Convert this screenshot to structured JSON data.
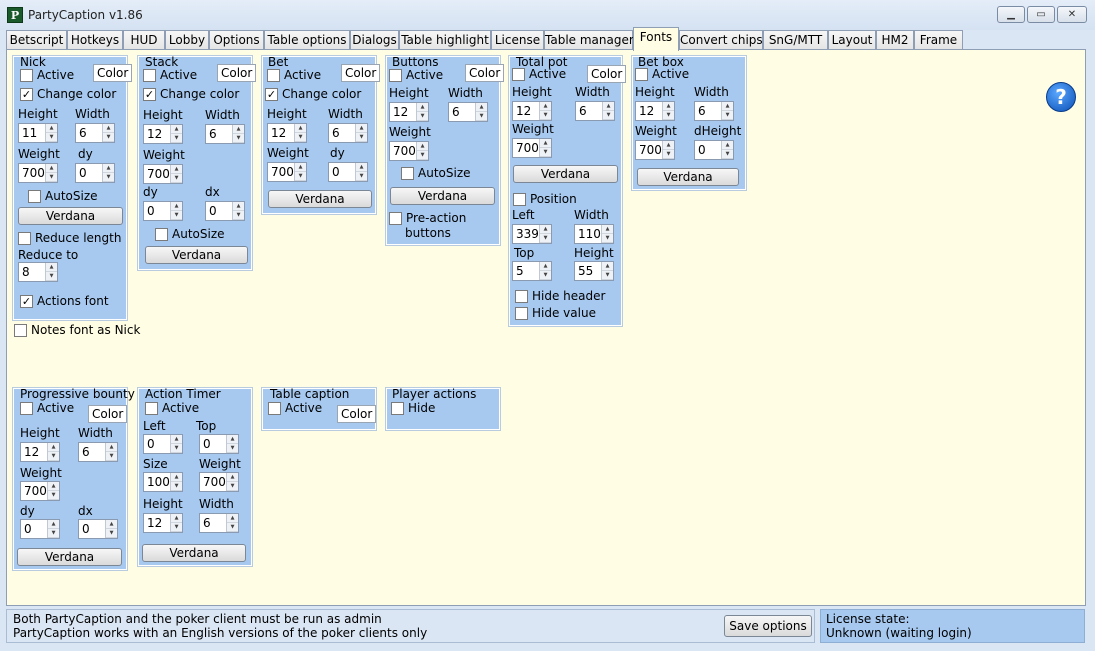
{
  "window": {
    "title": "PartyCaption v1.86",
    "icon_letter": "P",
    "minimize": "▁",
    "maximize": "▭",
    "close": "✕"
  },
  "tabs": [
    "Betscript",
    "Hotkeys",
    "HUD",
    "Lobby",
    "Options",
    "Table options",
    "Dialogs",
    "Table highlight",
    "License",
    "Table manager",
    "Fonts",
    "Convert chips",
    "SnG/MTT",
    "Layout",
    "HM2",
    "Frame"
  ],
  "active_tab": "Fonts",
  "common": {
    "active": "Active",
    "color": "Color",
    "change_color": "Change color",
    "height": "Height",
    "width": "Width",
    "weight": "Weight",
    "dy": "dy",
    "dx": "dx",
    "autosize": "AutoSize",
    "font": "Verdana",
    "left": "Left",
    "top": "Top",
    "size": "Size",
    "dheight": "dHeight",
    "check": "✓"
  },
  "nick": {
    "title": "Nick",
    "height": "11",
    "width": "6",
    "weight": "700",
    "dy": "0",
    "reduce_length": "Reduce length",
    "reduce_to_label": "Reduce to",
    "reduce_to": "8",
    "actions_font": "Actions font"
  },
  "notes_font": "Notes font as Nick",
  "stack": {
    "title": "Stack",
    "height": "12",
    "width": "6",
    "weight": "700",
    "dy": "0",
    "dx": "0"
  },
  "bet": {
    "title": "Bet",
    "height": "12",
    "width": "6",
    "weight": "700",
    "dy": "0"
  },
  "buttons": {
    "title": "Buttons",
    "height": "12",
    "width": "6",
    "weight": "700",
    "preaction": "Pre-action",
    "preaction2": "buttons"
  },
  "total_pot": {
    "title": "Total pot",
    "height": "12",
    "width": "6",
    "weight": "700",
    "position": "Position",
    "left": "339",
    "width2": "110",
    "top": "5",
    "height2": "55",
    "hide_header": "Hide header",
    "hide_value": "Hide value"
  },
  "bet_box": {
    "title": "Bet box",
    "height": "12",
    "width": "6",
    "weight": "700",
    "dheight": "0"
  },
  "progressive_bounty": {
    "title": "Progressive bounty",
    "height": "12",
    "width": "6",
    "weight": "700",
    "dy": "0",
    "dx": "0"
  },
  "action_timer": {
    "title": "Action Timer",
    "left": "0",
    "top": "0",
    "size": "100",
    "weight": "700",
    "height": "12",
    "width": "6"
  },
  "table_caption": {
    "title": "Table caption"
  },
  "player_actions": {
    "title": "Player actions",
    "hide": "Hide"
  },
  "status": {
    "line1": "Both PartyCaption and the poker client must be run as admin",
    "line2": "PartyCaption works with an English versions of the poker clients only",
    "save": "Save options"
  },
  "license": {
    "label": "License state:",
    "value": "Unknown (waiting login)"
  },
  "help": "?"
}
